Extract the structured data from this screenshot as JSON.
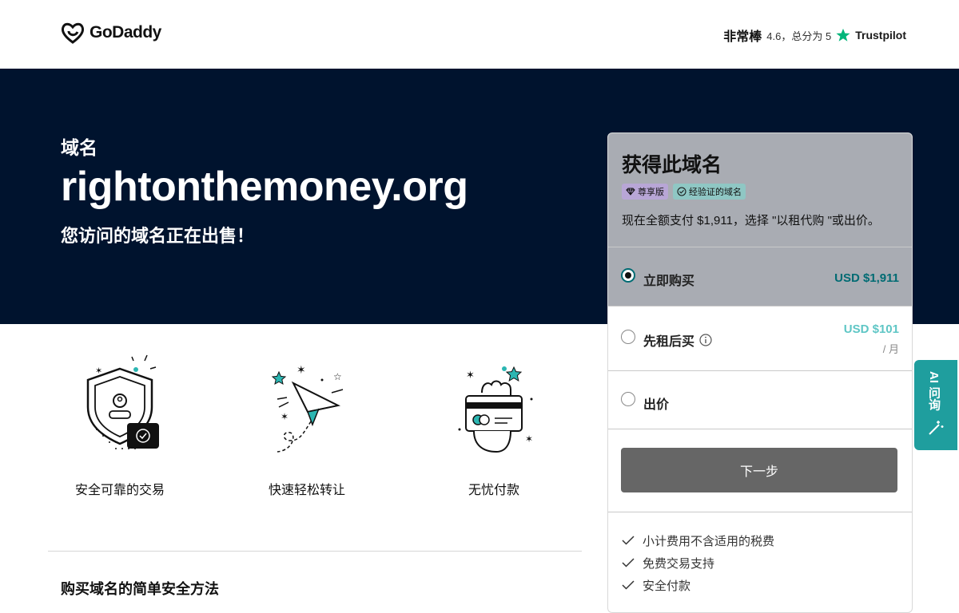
{
  "header": {
    "logo_text": "GoDaddy",
    "trust_rating_word": "非常棒",
    "trust_score": "4.6，总分为 5",
    "trust_brand": "Trustpilot"
  },
  "hero": {
    "label": "域名",
    "domain": "rightonthemoney.org",
    "subtitle": "您访问的域名正在出售！"
  },
  "features": [
    {
      "label": "安全可靠的交易",
      "icon": "shield-icon"
    },
    {
      "label": "快速轻松转让",
      "icon": "paper-plane-icon"
    },
    {
      "label": "无忧付款",
      "icon": "card-payment-icon"
    }
  ],
  "section_title": "购买域名的简单安全方法",
  "panel": {
    "title": "获得此域名",
    "badge_premium": "尊享版",
    "badge_verified": "经验证的域名",
    "description": "现在全额支付 $1,911，选择 \"以租代购 \"或出价。",
    "options": {
      "buy_now": {
        "label": "立即购买",
        "price": "USD $1,911",
        "selected": true
      },
      "lease": {
        "label": "先租后买",
        "price": "USD $101",
        "unit": "/ 月"
      },
      "offer": {
        "label": "出价"
      }
    },
    "next_button": "下一步",
    "checks": [
      "小计费用不含适用的税费",
      "免费交易支持",
      "安全付款"
    ]
  },
  "ai_tab": {
    "label": "AI 问询"
  },
  "colors": {
    "hero_bg": "#00132e",
    "accent": "#006b73",
    "ai_tab": "#1f9e9e",
    "button": "#666666"
  }
}
